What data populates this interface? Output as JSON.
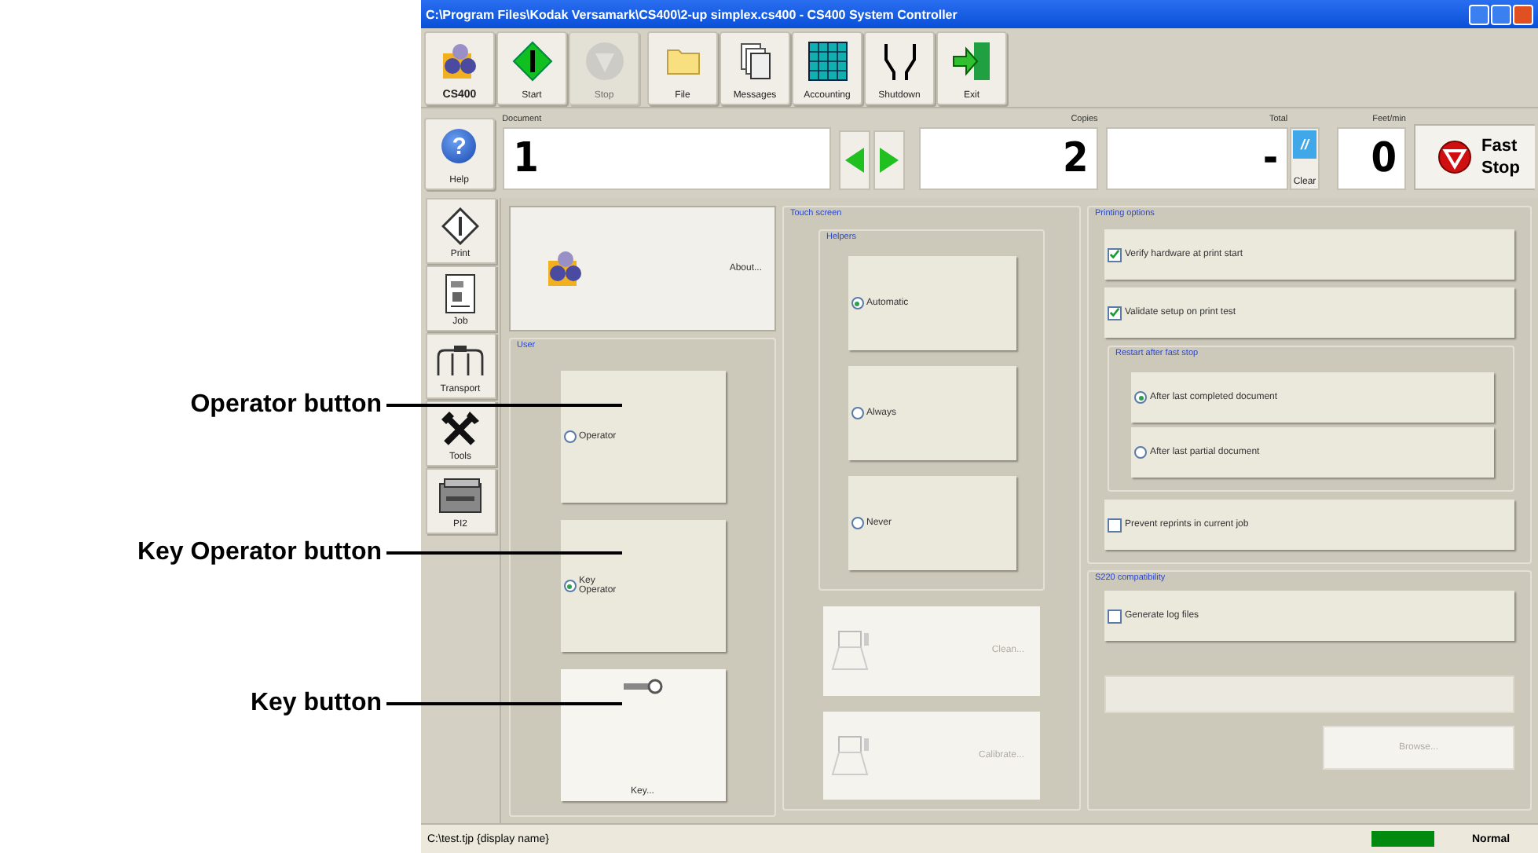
{
  "callouts": [
    {
      "label": "Operator button"
    },
    {
      "label": "Key Operator button"
    },
    {
      "label": "Key button"
    }
  ],
  "window": {
    "title": "C:\\Program Files\\Kodak Versamark\\CS400\\2-up simplex.cs400 - CS400 System Controller"
  },
  "toolbar": [
    {
      "kind": "logo",
      "label": "CS400",
      "disabled": false
    },
    {
      "kind": "start",
      "label": "Start",
      "disabled": false
    },
    {
      "kind": "stop",
      "label": "Stop",
      "disabled": true
    },
    {
      "kind": "file",
      "label": "File",
      "disabled": false
    },
    {
      "kind": "messages",
      "label": "Messages",
      "disabled": false
    },
    {
      "kind": "accounting",
      "label": "Accounting",
      "disabled": false
    },
    {
      "kind": "shutdown",
      "label": "Shutdown",
      "disabled": false
    },
    {
      "kind": "exit",
      "label": "Exit",
      "disabled": false
    }
  ],
  "help_button": {
    "glyph": "?",
    "label": "Help"
  },
  "document": {
    "label": "Document",
    "value": "1"
  },
  "copies": {
    "label": "Copies",
    "value": "2"
  },
  "total": {
    "label": "Total",
    "value": "-"
  },
  "clear_button": {
    "glyph": "//",
    "label": "Clear"
  },
  "feet_per_min": {
    "label": "Feet/min",
    "value": "0"
  },
  "fast_stop_button": {
    "label": "Fast Stop"
  },
  "sidebar": [
    {
      "kind": "print",
      "label": "Print"
    },
    {
      "kind": "job",
      "label": "Job"
    },
    {
      "kind": "transport",
      "label": "Transport"
    },
    {
      "kind": "tools",
      "label": "Tools"
    },
    {
      "kind": "pi2",
      "label": "PI2"
    }
  ],
  "about_button": {
    "label": "About..."
  },
  "user": {
    "title": "User",
    "options": [
      {
        "label": "Operator",
        "selected": false
      },
      {
        "label": "Key Operator",
        "selected": true
      }
    ],
    "key_button": {
      "label": "Key..."
    }
  },
  "touch_screen": {
    "title": "Touch screen",
    "helpers": {
      "title": "Helpers",
      "options": [
        {
          "label": "Automatic",
          "selected": true
        },
        {
          "label": "Always",
          "selected": false
        },
        {
          "label": "Never",
          "selected": false
        }
      ]
    },
    "buttons": [
      {
        "label": "Clean...",
        "disabled": true
      },
      {
        "label": "Calibrate...",
        "disabled": true
      }
    ]
  },
  "printing_options": {
    "title": "Printing options",
    "top_checks": [
      {
        "label": "Verify hardware at print start",
        "checked": true
      },
      {
        "label": "Validate setup on print test",
        "checked": true
      }
    ],
    "restart": {
      "title": "Restart after fast stop",
      "options": [
        {
          "label": "After last completed document",
          "selected": true
        },
        {
          "label": "After last partial document",
          "selected": false
        }
      ]
    },
    "bottom_checks": [
      {
        "label": "Prevent reprints in current job",
        "checked": false
      }
    ]
  },
  "s220": {
    "title": "S220 compatibility",
    "checks": [
      {
        "label": "Generate log files",
        "checked": false
      }
    ],
    "path_field": {
      "disabled": true
    },
    "browse_button": {
      "label": "Browse...",
      "disabled": true
    }
  },
  "status_bar": {
    "path": "C:\\test.tjp {display name}",
    "mode": "Normal"
  }
}
